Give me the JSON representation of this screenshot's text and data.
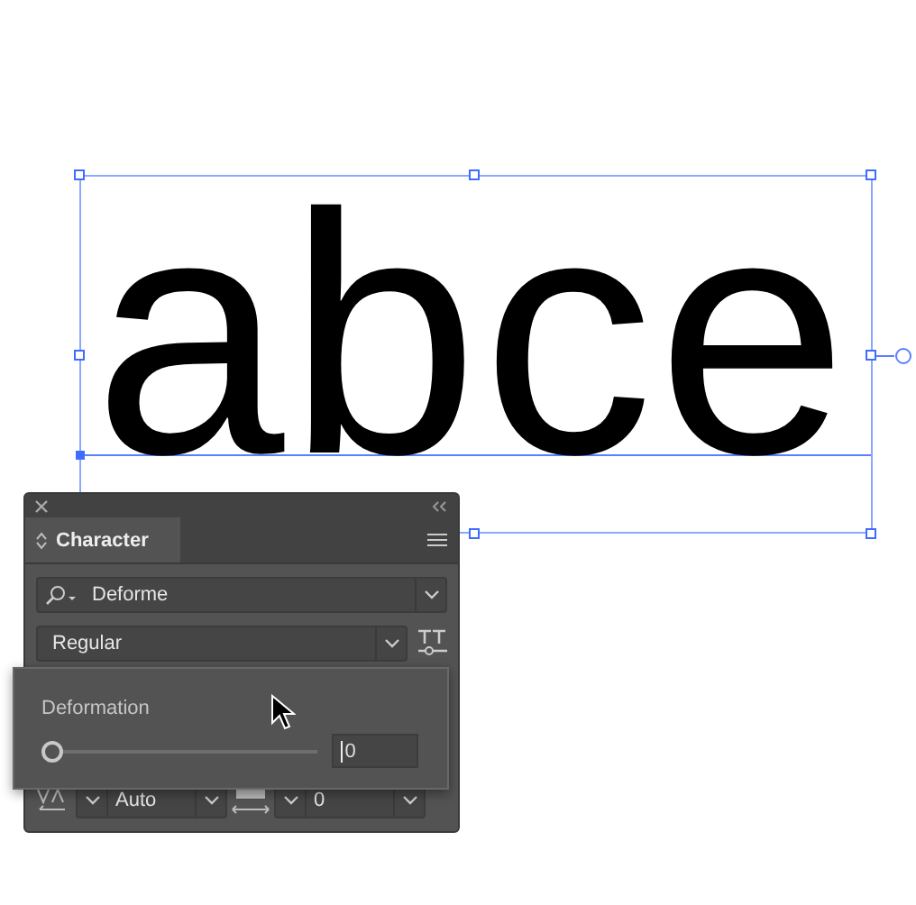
{
  "canvas": {
    "text": "abce"
  },
  "panel": {
    "tab": {
      "label": "Character",
      "selected": true
    },
    "font_family": "Deforme",
    "font_style": "Regular",
    "kerning": "Auto",
    "tracking": "0"
  },
  "popup": {
    "label": "Deformation",
    "level": 0,
    "value": "0"
  }
}
